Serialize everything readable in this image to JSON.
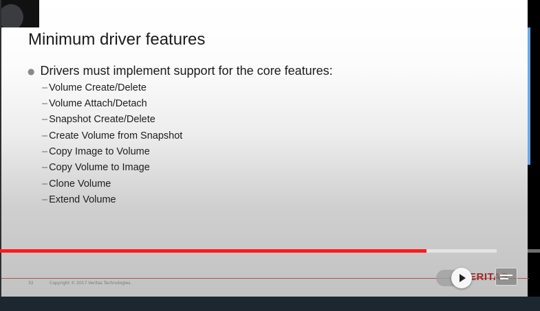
{
  "slide": {
    "title": "Minimum driver features",
    "bullet": "Drivers must implement support for the core features:",
    "subitems": [
      "Volume Create/Delete",
      "Volume Attach/Detach",
      "Snapshot Create/Delete",
      "Create Volume from Snapshot",
      "Copy Image to Volume",
      "Copy Volume to Image",
      "Clone Volume",
      "Extend Volume"
    ],
    "footer_page": "32",
    "footer_copyright": "Copyright © 2017 Veritas Technologies.",
    "logo_text": "ERITAS"
  },
  "player": {
    "progress_played": 0.79,
    "progress_buffered": 0.92,
    "progress_color": "#ff1a1a",
    "autoplay_icon": "play-icon",
    "captions_icon": "captions-icon"
  }
}
